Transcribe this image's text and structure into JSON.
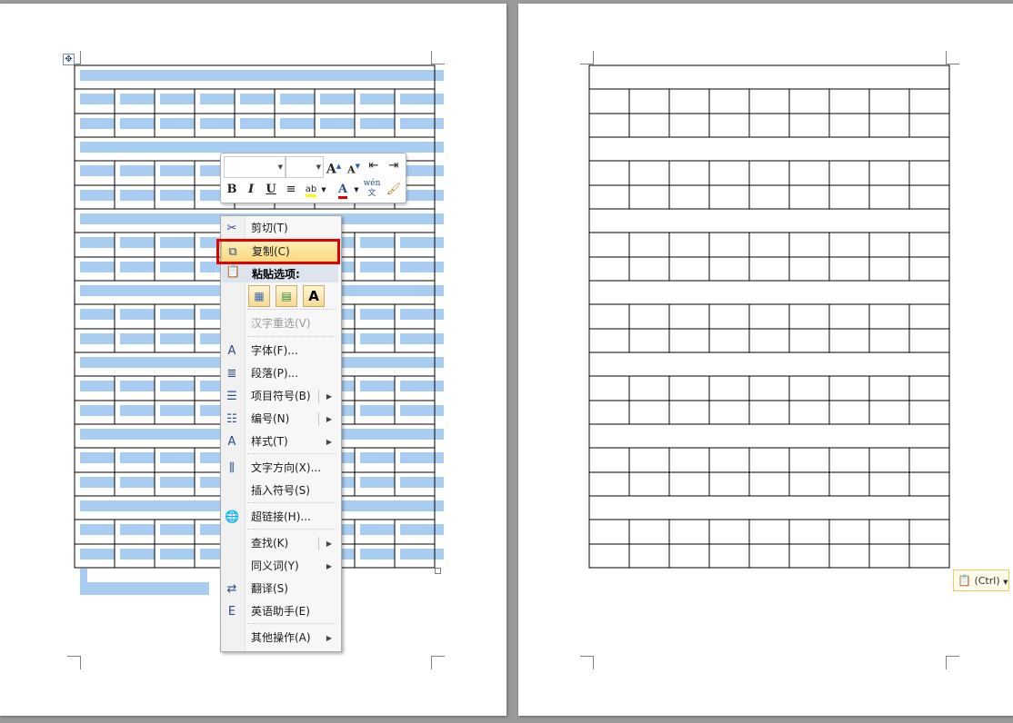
{
  "context_menu": {
    "items": [
      {
        "name": "cut",
        "icon": "scissors-icon",
        "glyph": "✂",
        "label": "剪切(T)",
        "submenu": false,
        "disabled": false
      },
      {
        "name": "copy",
        "icon": "copy-icon",
        "glyph": "⧉",
        "label": "复制(C)",
        "submenu": false,
        "disabled": false,
        "highlighted": true
      },
      {
        "name": "chinese-reconvert",
        "icon": "",
        "glyph": "",
        "label": "汉字重选(V)",
        "submenu": false,
        "disabled": true
      },
      {
        "name": "font",
        "icon": "font-icon",
        "glyph": "A",
        "label": "字体(F)...",
        "submenu": false,
        "disabled": false
      },
      {
        "name": "paragraph",
        "icon": "paragraph-icon",
        "glyph": "≣",
        "label": "段落(P)...",
        "submenu": false,
        "disabled": false
      },
      {
        "name": "bullets",
        "icon": "bullet-list-icon",
        "glyph": "☰",
        "label": "项目符号(B)",
        "submenu": true,
        "split": true,
        "disabled": false
      },
      {
        "name": "numbering",
        "icon": "numbered-list-icon",
        "glyph": "☷",
        "label": "编号(N)",
        "submenu": true,
        "split": true,
        "disabled": false
      },
      {
        "name": "styles",
        "icon": "styles-icon",
        "glyph": "A",
        "label": "样式(T)",
        "submenu": true,
        "disabled": false
      },
      {
        "name": "text-direction",
        "icon": "text-direction-icon",
        "glyph": "⫼",
        "label": "文字方向(X)...",
        "submenu": false,
        "disabled": false
      },
      {
        "name": "insert-symbol",
        "icon": "",
        "glyph": "",
        "label": "插入符号(S)",
        "submenu": false,
        "disabled": false
      },
      {
        "name": "hyperlink",
        "icon": "hyperlink-icon",
        "glyph": "🌐",
        "label": "超链接(H)...",
        "submenu": false,
        "disabled": false
      },
      {
        "name": "lookup",
        "icon": "",
        "glyph": "",
        "label": "查找(K)",
        "submenu": true,
        "split": true,
        "disabled": false
      },
      {
        "name": "synonyms",
        "icon": "",
        "glyph": "",
        "label": "同义词(Y)",
        "submenu": true,
        "disabled": false
      },
      {
        "name": "translate",
        "icon": "translate-icon",
        "glyph": "⇄",
        "label": "翻译(S)",
        "submenu": false,
        "disabled": false
      },
      {
        "name": "english-assistant",
        "icon": "english-assistant-icon",
        "glyph": "E",
        "label": "英语助手(E)",
        "submenu": false,
        "disabled": false
      },
      {
        "name": "other-actions",
        "icon": "",
        "glyph": "",
        "label": "其他操作(A)",
        "submenu": true,
        "disabled": false
      }
    ],
    "paste_header": "粘贴选项:",
    "paste_options": [
      "keep-source-formatting-icon",
      "merge-table-icon",
      "keep-text-only-icon"
    ],
    "paste_keep_text_glyph": "A"
  },
  "mini_toolbar": {
    "font_name": "",
    "font_size": "",
    "grow_font": "A",
    "shrink_font": "A",
    "bold": "B",
    "italic": "I",
    "underline": "U",
    "font_color": "A",
    "phonetic_guide": "wén 文",
    "font_color_hex": "#e00000",
    "highlight_hex": "#ffff00"
  },
  "paste_ctrl": {
    "label": "(Ctrl)"
  },
  "colors": {
    "selection": "#a9cdf0",
    "highlight_border": "#e00000"
  }
}
